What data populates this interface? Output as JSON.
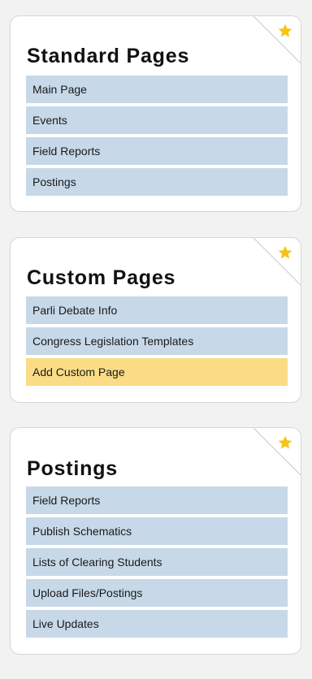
{
  "colors": {
    "item_background": "#c7d8e8",
    "highlight_background": "#fadc86",
    "star": "#f6c417"
  },
  "panels": [
    {
      "title": "Standard Pages",
      "icon": "star-icon",
      "items": [
        {
          "label": "Main Page"
        },
        {
          "label": "Events"
        },
        {
          "label": "Field Reports"
        },
        {
          "label": "Postings"
        }
      ]
    },
    {
      "title": "Custom Pages",
      "icon": "star-icon",
      "items": [
        {
          "label": "Parli Debate Info"
        },
        {
          "label": "Congress Legislation Templates"
        },
        {
          "label": "Add Custom Page",
          "highlighted": true
        }
      ]
    },
    {
      "title": "Postings",
      "icon": "star-icon",
      "items": [
        {
          "label": "Field Reports"
        },
        {
          "label": "Publish Schematics"
        },
        {
          "label": "Lists of Clearing Students"
        },
        {
          "label": "Upload Files/Postings"
        },
        {
          "label": "Live Updates"
        }
      ]
    }
  ]
}
